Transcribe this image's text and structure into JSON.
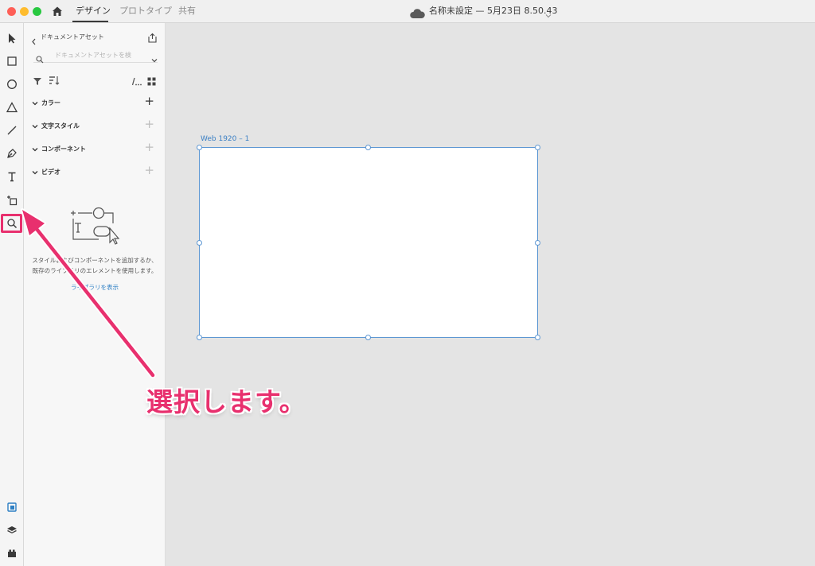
{
  "window": {
    "tabs": [
      "デザイン",
      "プロトタイプ",
      "共有"
    ],
    "active_tab": "デザイン",
    "document_title": "名称未設定 — 5月23日 8.50.43"
  },
  "toolbar": {
    "tools": [
      "select-tool",
      "rectangle-tool",
      "ellipse-tool",
      "polygon-tool",
      "line-tool",
      "pen-tool",
      "text-tool",
      "artboard-tool",
      "zoom-tool"
    ],
    "bottom": [
      "assets-panel-icon",
      "layers-icon",
      "plugins-icon"
    ],
    "highlighted_tool": "artboard-tool"
  },
  "assets_panel": {
    "title": "ドキュメントアセット",
    "search_placeholder": "ドキュメントアセットを検",
    "sections": [
      {
        "label": "カラー"
      },
      {
        "label": "文字スタイル"
      },
      {
        "label": "コンポーネント"
      },
      {
        "label": "ビデオ"
      }
    ],
    "empty_text": "スタイルおよびコンポーネントを追加するか、既存のライブラリのエレメントを使用します。",
    "library_link": "ライブラリを表示"
  },
  "canvas": {
    "artboard_label": "Web 1920 – 1"
  },
  "annotation": {
    "text": "選択します。",
    "color": "#e8306e"
  },
  "colors": {
    "accent": "#e8306e",
    "selection": "#5d97d3",
    "link": "#2d7fc4"
  }
}
